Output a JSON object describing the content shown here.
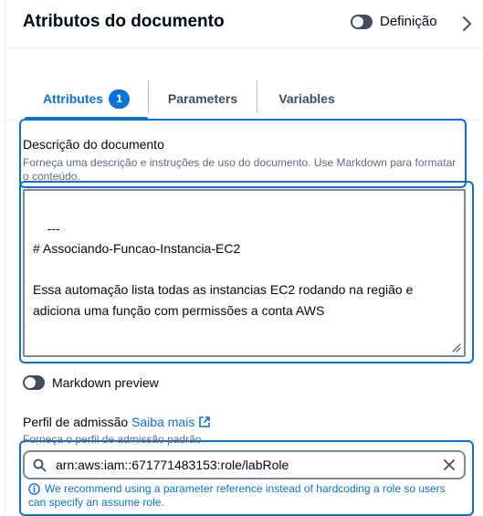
{
  "header": {
    "title": "Atributos do documento",
    "toggle_label": "Definição"
  },
  "tabs": [
    {
      "label": "Attributes",
      "badge": "1",
      "active": true
    },
    {
      "label": "Parameters",
      "active": false
    },
    {
      "label": "Variables",
      "active": false
    }
  ],
  "description": {
    "label": "Descrição do documento",
    "hint_line1": "Forneça uma descrição e instruções de uso do documento. Use Markdown para formatar",
    "hint_line2": "o conteúdo.",
    "value": "---\n# Associando-Funcao-Instancia-EC2\n\nEssa automação lista todas as instancias EC2 rodando na região e\nadiciona uma função com permissões a conta AWS"
  },
  "markdown_preview": {
    "label": "Markdown preview"
  },
  "role": {
    "label": "Perfil de admissão",
    "link": "Saiba mais",
    "hint": "Forneça o perfil de admissão padrão",
    "value": "arn:aws:iam::671771483153:role/labRole",
    "warning_line1": "We recommend using a parameter reference instead of hardcoding a role so users",
    "warning_line2": "can specify an assume role."
  },
  "colors": {
    "accent": "#0972d3",
    "text": "#000716",
    "muted": "#5f6b7a"
  }
}
